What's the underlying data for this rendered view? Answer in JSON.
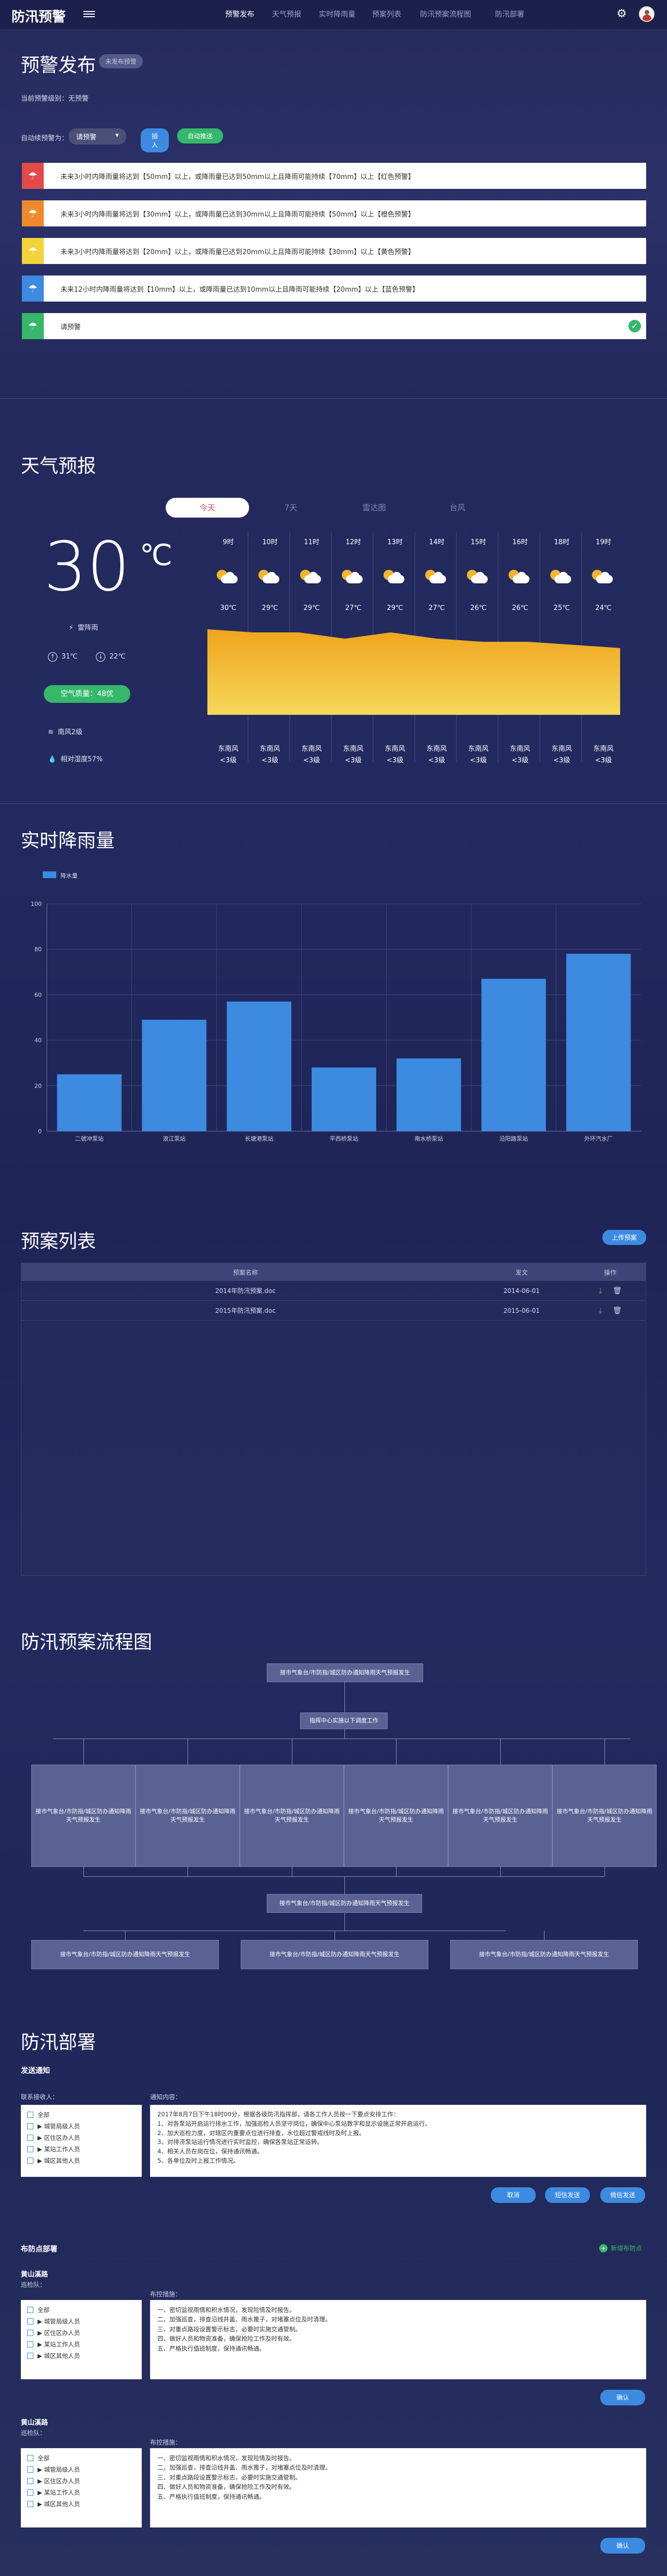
{
  "header": {
    "logo": "防汛预警",
    "nav": [
      "预警发布",
      "天气预报",
      "实时降雨量",
      "预案列表",
      "防汛预案流程图",
      "防汛部署"
    ],
    "active_index": 0
  },
  "alert": {
    "title": "预警发布",
    "badge": "未发布预警",
    "current_level": "当前预警级别：无预警",
    "auto_label": "自动续预警为：",
    "select_value": "请预警",
    "btn_insert": "插入",
    "btn_auto": "自动推送",
    "items": [
      {
        "color": "#e24a4a",
        "text": "未来3小时内降雨量将达到【50mm】以上，或降雨量已达到50mm以上且降雨可能持续【70mm】以上【红色预警】",
        "checked": false
      },
      {
        "color": "#ee8a2b",
        "text": "未来3小时内降雨量将达到【30mm】以上，或降雨量已达到30mm以上且降雨可能持续【50mm】以上【橙色预警】",
        "checked": false
      },
      {
        "color": "#f2d33a",
        "text": "未来3小时内降雨量将达到【20mm】以上，或降雨量已达到20mm以上且降雨可能持续【30mm】以上【黄色预警】",
        "checked": false
      },
      {
        "color": "#3c8be0",
        "text": "未来12小时内降雨量将达到【10mm】以上，或降雨量已达到10mm以上且降雨可能持续【20mm】以上【蓝色预警】",
        "checked": false
      },
      {
        "color": "#35b86a",
        "text": "请预警",
        "checked": true
      }
    ]
  },
  "weather": {
    "title": "天气预报",
    "tabs": [
      "今天",
      "7天",
      "雷达图",
      "台风"
    ],
    "active_tab": 0,
    "temp": "30",
    "unit": "℃",
    "condition": "雷阵雨",
    "high": "31℃",
    "low": "22℃",
    "aqi": "空气质量：48优",
    "wind": "南风2级",
    "humidity": "相对湿度57%",
    "hours": [
      "9时",
      "10时",
      "11时",
      "12时",
      "13时",
      "14时",
      "15时",
      "16时",
      "18时",
      "19时"
    ],
    "temps": [
      "30℃",
      "29℃",
      "29℃",
      "27℃",
      "29℃",
      "27℃",
      "26℃",
      "26℃",
      "25℃",
      "24℃"
    ],
    "temp_values": [
      30,
      29,
      29,
      27,
      29,
      27,
      26,
      26,
      25,
      24
    ],
    "winds": [
      "东南风",
      "东南风",
      "东南风",
      "东南风",
      "东南风",
      "东南风",
      "东南风",
      "东南风",
      "东南风",
      "东南风"
    ],
    "wind_levels": [
      "<3级",
      "<3级",
      "<3级",
      "<3级",
      "<3级",
      "<3级",
      "<3级",
      "<3级",
      "<3级",
      "<3级"
    ]
  },
  "rain": {
    "title": "实时降雨量",
    "chart_data": {
      "type": "bar",
      "categories": [
        "二號冲泵站",
        "浪江泵站",
        "长塘港泵站",
        "平西桥泵站",
        "南水桥泵站",
        "沿阳路泵站",
        "外环汽水厂"
      ],
      "series": [
        {
          "name": "降水量",
          "values": [
            25,
            49,
            57,
            28,
            32,
            67,
            78
          ]
        }
      ],
      "ylim": [
        0,
        100
      ],
      "yticks": [
        "0",
        "20",
        "40",
        "60",
        "80",
        "100"
      ],
      "legend": "top-left",
      "color": "#3c8be0"
    }
  },
  "plans": {
    "title": "预案列表",
    "upload_btn": "上传预案",
    "headers": [
      "预案名称",
      "发文",
      "操作"
    ],
    "rows": [
      {
        "name": "2014年防汛预案.doc",
        "date": "2014-06-01"
      },
      {
        "name": "2015年防汛预案.doc",
        "date": "2015-06-01"
      }
    ]
  },
  "flow": {
    "title": "防汛预案流程图",
    "top": "接市气象台/市防指/城区防办通知降雨天气预报发生",
    "mid": "指挥中心实施以下调度工作",
    "boxes": [
      "接市气象台/市防指/城区防办通知降雨天气预报发生",
      "接市气象台/市防指/城区防办通知降雨天气预报发生",
      "接市气象台/市防指/城区防办通知降雨天气预报发生",
      "接市气象台/市防指/城区防办通知降雨天气预报发生",
      "接市气象台/市防指/城区防办通知降雨天气预报发生",
      "接市气象台/市防指/城区防办通知降雨天气预报发生"
    ],
    "merge": "接市气象台/市防指/城区防办通知降雨天气预报发生",
    "bottom": [
      "接市气象台/市防指/城区防办通知降雨天气预报发生",
      "接市气象台/市防指/城区防办通知降雨天气预报发生",
      "接市气象台/市防指/城区防办通知降雨天气预报发生"
    ]
  },
  "deploy": {
    "title": "防汛部署",
    "notify": {
      "title": "发送通知",
      "recipient_label": "联系接收人：",
      "content_label": "通知内容：",
      "recipients": [
        "全部",
        "▶ 城管局级人员",
        "▶ 区住区办人员",
        "▶ 某站工作人员",
        "▶ 城区其他人员"
      ],
      "content": [
        "2017年8月7日下午18时00分，根据各级防汛指挥部，请各工作人员按一下要点安排工作：",
        "1、对各泵站开启运行排水工作，加强巡检人员坚守岗位，确保中心泵站数字和显示设施正常开启运行。",
        "2、加大巡检力度，对辖区内重要点位进行排查，水位超过警戒线时及时上报。",
        "3、对排涝泵站运行情况进行实时监控，确保各泵站正常运转。",
        "4、相关人员在岗在位，保持通讯畅通。",
        "5、各单位及时上报工作情况。"
      ],
      "buttons": [
        "取消",
        "短信发送",
        "微信发送"
      ]
    },
    "points_title": "布防点部署",
    "add_point": "新增布防点",
    "points": [
      {
        "name": "黄山溪路",
        "staff_label": "巡检队：",
        "plan_label": "布控措施：",
        "staff": [
          "全部",
          "▶ 城管局级人员",
          "▶ 区住区办人员",
          "▶ 某站工作人员",
          "▶ 城区其他人员"
        ],
        "plan": [
          "一、密切监视雨情和积水情况，发现险情及时报告。",
          "二、加强巡查，排查沿线井盖、雨水篦子，对堵塞点位及时清理。",
          "三、对重点路段设置警示标志，必要时实施交通管制。",
          "四、做好人员和物资准备，确保抢险工作及时有效。",
          "五、严格执行值班制度，保持通讯畅通。"
        ],
        "button": "确认"
      },
      {
        "name": "黄山溪路",
        "staff_label": "巡检队：",
        "plan_label": "布控措施：",
        "staff": [
          "全部",
          "▶ 城管局级人员",
          "▶ 区住区办人员",
          "▶ 某站工作人员",
          "▶ 城区其他人员"
        ],
        "plan": [
          "一、密切监视雨情和积水情况，发现险情及时报告。",
          "二、加强巡查，排查沿线井盖、雨水篦子，对堵塞点位及时清理。",
          "三、对重点路段设置警示标志，必要时实施交通管制。",
          "四、做好人员和物资准备，确保抢险工作及时有效。",
          "五、严格执行值班制度，保持通讯畅通。"
        ],
        "button": "确认"
      }
    ]
  }
}
